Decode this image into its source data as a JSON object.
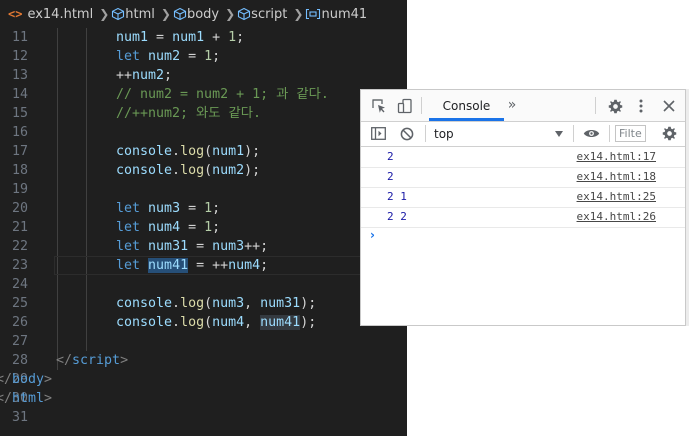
{
  "breadcrumb": {
    "file": "ex14.html",
    "items": [
      "html",
      "body",
      "script",
      "num41"
    ]
  },
  "editor": {
    "lines": [
      {
        "n": "11",
        "tokens": [
          [
            "var",
            "num1"
          ],
          [
            "op",
            " = "
          ],
          [
            "var",
            "num1"
          ],
          [
            "op",
            " + "
          ],
          [
            "num",
            "1"
          ],
          [
            "op",
            ";"
          ]
        ]
      },
      {
        "n": "12",
        "tokens": [
          [
            "kw",
            "let"
          ],
          [
            "op",
            " "
          ],
          [
            "var",
            "num2"
          ],
          [
            "op",
            " = "
          ],
          [
            "num",
            "1"
          ],
          [
            "op",
            ";"
          ]
        ]
      },
      {
        "n": "13",
        "tokens": [
          [
            "op",
            "++"
          ],
          [
            "var",
            "num2"
          ],
          [
            "op",
            ";"
          ]
        ]
      },
      {
        "n": "14",
        "tokens": [
          [
            "cm",
            "// num2 = num2 + 1; 과 같다."
          ]
        ]
      },
      {
        "n": "15",
        "tokens": [
          [
            "cm",
            "//++num2; 와도 같다."
          ]
        ]
      },
      {
        "n": "16",
        "tokens": []
      },
      {
        "n": "17",
        "tokens": [
          [
            "var",
            "console"
          ],
          [
            "op",
            "."
          ],
          [
            "fn",
            "log"
          ],
          [
            "op",
            "("
          ],
          [
            "var",
            "num1"
          ],
          [
            "op",
            ");"
          ]
        ]
      },
      {
        "n": "18",
        "tokens": [
          [
            "var",
            "console"
          ],
          [
            "op",
            "."
          ],
          [
            "fn",
            "log"
          ],
          [
            "op",
            "("
          ],
          [
            "var",
            "num2"
          ],
          [
            "op",
            ");"
          ]
        ]
      },
      {
        "n": "19",
        "tokens": []
      },
      {
        "n": "20",
        "tokens": [
          [
            "kw",
            "let"
          ],
          [
            "op",
            " "
          ],
          [
            "var",
            "num3"
          ],
          [
            "op",
            " = "
          ],
          [
            "num",
            "1"
          ],
          [
            "op",
            ";"
          ]
        ]
      },
      {
        "n": "21",
        "tokens": [
          [
            "kw",
            "let"
          ],
          [
            "op",
            " "
          ],
          [
            "var",
            "num4"
          ],
          [
            "op",
            " = "
          ],
          [
            "num",
            "1"
          ],
          [
            "op",
            ";"
          ]
        ]
      },
      {
        "n": "22",
        "tokens": [
          [
            "kw",
            "let"
          ],
          [
            "op",
            " "
          ],
          [
            "var",
            "num31"
          ],
          [
            "op",
            " = "
          ],
          [
            "var",
            "num3"
          ],
          [
            "op",
            "++;"
          ]
        ]
      },
      {
        "n": "23",
        "current": true,
        "tokens": [
          [
            "kw",
            "let"
          ],
          [
            "op",
            " "
          ],
          [
            "var hl",
            "num4"
          ],
          [
            "caret",
            ""
          ],
          [
            "var hl",
            "1"
          ],
          [
            "op",
            " = ++"
          ],
          [
            "var",
            "num4"
          ],
          [
            "op",
            ";"
          ]
        ]
      },
      {
        "n": "24",
        "tokens": []
      },
      {
        "n": "25",
        "tokens": [
          [
            "var",
            "console"
          ],
          [
            "op",
            "."
          ],
          [
            "fn",
            "log"
          ],
          [
            "op",
            "("
          ],
          [
            "var",
            "num3"
          ],
          [
            "op",
            ", "
          ],
          [
            "var",
            "num31"
          ],
          [
            "op",
            ");"
          ]
        ]
      },
      {
        "n": "26",
        "tokens": [
          [
            "var",
            "console"
          ],
          [
            "op",
            "."
          ],
          [
            "fn",
            "log"
          ],
          [
            "op",
            "("
          ],
          [
            "var",
            "num4"
          ],
          [
            "op",
            ", "
          ],
          [
            "var hl2",
            "num41"
          ],
          [
            "op",
            ");"
          ]
        ]
      },
      {
        "n": "27",
        "tokens": []
      },
      {
        "n": "28",
        "indent": 1,
        "tokens": [
          [
            "tag",
            "</"
          ],
          [
            "tn",
            "script"
          ],
          [
            "tag",
            ">"
          ]
        ]
      },
      {
        "n": "29",
        "indent": 0,
        "tokens": [
          [
            "tag",
            "</"
          ],
          [
            "tn",
            "body"
          ],
          [
            "tag",
            ">"
          ]
        ]
      },
      {
        "n": "30",
        "indent": 0,
        "tokens": [
          [
            "tag",
            "</"
          ],
          [
            "tn",
            "html"
          ],
          [
            "tag",
            ">"
          ]
        ]
      },
      {
        "n": "31",
        "indent": 0,
        "tokens": []
      }
    ]
  },
  "devtools": {
    "tab": "Console",
    "more_tabs": "»",
    "context": "top",
    "filter_placeholder": "Filte",
    "messages": [
      {
        "value": "2",
        "source": "ex14.html:17"
      },
      {
        "value": "2",
        "source": "ex14.html:18"
      },
      {
        "value": "2 1",
        "source": "ex14.html:25"
      },
      {
        "value": "2 2",
        "source": "ex14.html:26"
      }
    ],
    "prompt": "›"
  }
}
